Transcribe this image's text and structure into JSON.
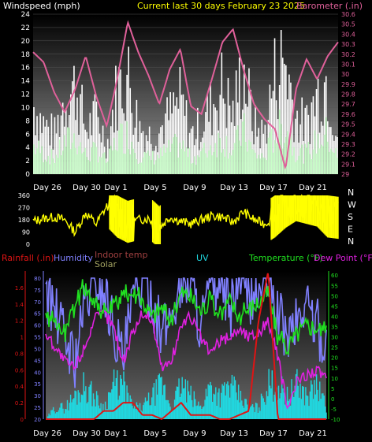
{
  "colors": {
    "wind": "#ffffff",
    "wind_avg": "#c8ffc8",
    "baro": "#e0609a",
    "wind_dir": "#ffff00",
    "rain": "#e01414",
    "humidity": "#8080ff",
    "indoor": "#808080",
    "solar": "#e0e060",
    "uv": "#20d8e0",
    "temperature": "#20e020",
    "dewpoint": "#e020e0"
  },
  "chart_data": [
    {
      "type": "line",
      "title": "Current last 30 days February 23 2025",
      "left_axis_label": "Windspeed (mph)",
      "right_axis_label": "Barometer (.in)",
      "ylim": [
        0,
        24
      ],
      "y_ticks": [
        "0",
        "2",
        "4",
        "6",
        "8",
        "10",
        "12",
        "14",
        "16",
        "18",
        "20",
        "22",
        "24"
      ],
      "y2lim": [
        29.0,
        30.6
      ],
      "y2_ticks": [
        "29",
        "29.1",
        "29.2",
        "29.3",
        "29.4",
        "29.5",
        "29.6",
        "29.7",
        "29.8",
        "29.9",
        "30",
        "30.1",
        "30.2",
        "30.3",
        "30.4",
        "30.5",
        "30.6"
      ],
      "x_ticks": [
        "Day 26",
        "Day 30",
        "Day 1",
        "Day 5",
        "Day 9",
        "Day 13",
        "Day 17",
        "Day 21"
      ],
      "x_day": [
        0,
        1,
        2,
        3,
        4,
        5,
        6,
        7,
        8,
        9,
        10,
        11,
        12,
        13,
        14,
        15,
        16,
        17,
        18,
        19,
        20,
        21,
        22,
        23,
        24,
        25,
        26,
        27,
        28,
        29
      ],
      "series": [
        {
          "name": "Windspeed (mph)",
          "values": [
            14,
            10,
            8,
            16,
            18,
            9,
            12,
            6,
            18,
            20,
            10,
            8,
            9,
            12,
            15,
            8,
            10,
            14,
            18,
            12,
            22,
            10,
            8,
            20,
            24,
            12,
            10,
            16,
            20,
            8
          ]
        },
        {
          "name": "Barometer (.in)",
          "values": [
            30.22,
            30.12,
            29.82,
            29.62,
            29.85,
            30.18,
            29.78,
            29.48,
            29.95,
            30.52,
            30.22,
            29.98,
            29.7,
            30.05,
            30.25,
            29.68,
            29.6,
            29.95,
            30.32,
            30.45,
            30.05,
            29.7,
            29.55,
            29.45,
            29.05,
            29.85,
            30.15,
            29.95,
            30.18,
            30.32
          ]
        }
      ]
    },
    {
      "type": "line",
      "title": "",
      "y_ticks": [
        "0",
        "90",
        "180",
        "270",
        "360"
      ],
      "ylim": [
        0,
        360
      ],
      "right_labels": [
        "N",
        "W",
        "S",
        "E",
        "N"
      ],
      "x_ticks": [
        "Day 26",
        "Day 30",
        "Day 1",
        "Day 5",
        "Day 9",
        "Day 13",
        "Day 17",
        "Day 21"
      ],
      "series": [
        {
          "name": "Wind direction",
          "values": [
            170,
            190,
            200,
            180,
            90,
            230,
            150,
            280,
            200,
            160,
            180,
            190,
            120,
            200,
            170,
            150,
            180,
            210,
            200,
            160,
            240,
            180,
            150,
            200,
            270,
            320,
            300,
            280,
            200,
            190
          ]
        }
      ]
    },
    {
      "type": "line",
      "title": "",
      "legend": [
        "Rainfall (.in)",
        "Humidity",
        "Indoor temp",
        "Solar",
        "UV",
        "Temperature (°F)",
        "Dew Point (°F)"
      ],
      "rain_ticks": [
        "0",
        "0.2",
        "0.4",
        "0.6",
        "0.8",
        "1",
        "1.2",
        "1.4",
        "1.6"
      ],
      "rain_lim": [
        0,
        1.8
      ],
      "hum_ticks": [
        "20",
        "25",
        "30",
        "35",
        "40",
        "45",
        "50",
        "55",
        "60",
        "65",
        "70",
        "75",
        "80"
      ],
      "hum_lim": [
        20,
        83
      ],
      "temp_ticks": [
        "-10",
        "-5",
        "0",
        "5",
        "10",
        "15",
        "20",
        "25",
        "30",
        "35",
        "40",
        "45",
        "50",
        "55",
        "60"
      ],
      "temp_lim": [
        -10,
        62
      ],
      "x_ticks": [
        "Day 26",
        "Day 30",
        "Day 1",
        "Day 5",
        "Day 9",
        "Day 13",
        "Day 17",
        "Day 21"
      ],
      "series": [
        {
          "name": "Rainfall (.in)",
          "values": [
            0,
            0,
            0,
            0,
            0,
            0,
            0.1,
            0.1,
            0.2,
            0.2,
            0.05,
            0.05,
            0,
            0.1,
            0.2,
            0.05,
            0.05,
            0.05,
            0,
            0,
            0.05,
            0.1,
            1.2,
            1.8,
            0,
            0,
            0,
            0,
            0,
            0
          ]
        },
        {
          "name": "Humidity",
          "values": [
            75,
            65,
            55,
            45,
            68,
            80,
            75,
            60,
            45,
            70,
            80,
            72,
            55,
            65,
            78,
            80,
            60,
            75,
            80,
            65,
            80,
            72,
            75,
            80,
            65,
            55,
            62,
            70,
            60,
            50
          ]
        },
        {
          "name": "Temperature (°F)",
          "values": [
            37,
            38,
            32,
            45,
            55,
            48,
            42,
            44,
            50,
            52,
            48,
            40,
            45,
            38,
            52,
            50,
            43,
            48,
            40,
            48,
            40,
            44,
            47,
            52,
            30,
            25,
            32,
            36,
            35,
            32
          ]
        },
        {
          "name": "Dew Point (°F)",
          "values": [
            32,
            25,
            18,
            15,
            25,
            38,
            42,
            35,
            18,
            32,
            42,
            38,
            15,
            18,
            36,
            40,
            30,
            22,
            28,
            30,
            34,
            30,
            32,
            38,
            20,
            -5,
            8,
            12,
            14,
            10
          ]
        },
        {
          "name": "UV",
          "values": [
            0,
            1,
            1,
            2,
            3,
            2,
            1,
            3,
            3,
            1,
            1,
            2,
            3,
            1,
            3,
            2,
            1,
            3,
            2,
            3,
            2,
            1,
            1,
            3,
            3,
            2,
            3,
            2,
            3,
            1
          ]
        }
      ]
    }
  ]
}
